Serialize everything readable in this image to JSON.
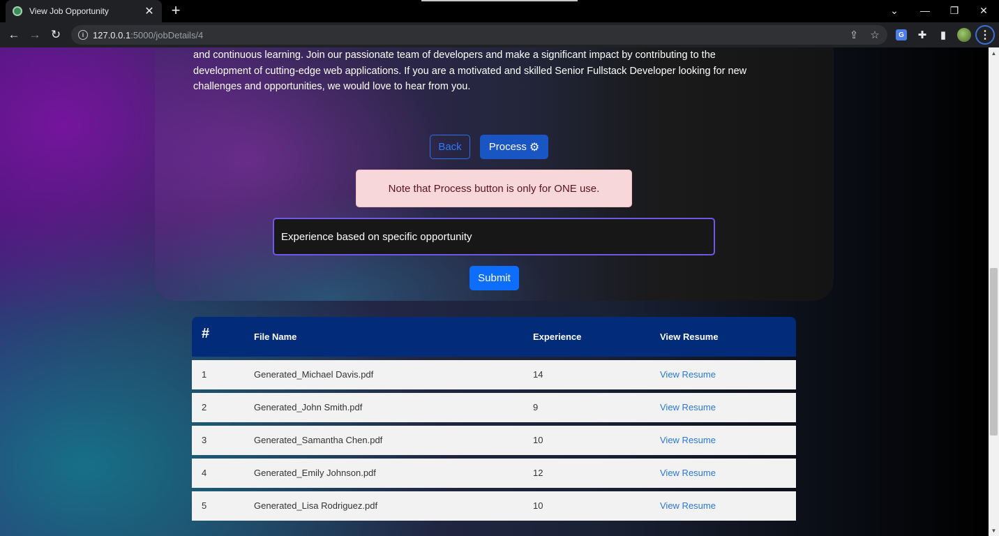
{
  "browser": {
    "tab_title": "View Job Opportunity",
    "url_host": "127.0.0.1",
    "url_path": ":5000/jobDetails/4",
    "new_tab_symbol": "+",
    "close_symbol": "✕"
  },
  "page": {
    "description": "and continuous learning. Join our passionate team of developers and make a significant impact by contributing to the development of cutting-edge web applications. If you are a motivated and skilled Senior Fullstack Developer looking for new challenges and opportunities, we would love to hear from you.",
    "back_label": "Back",
    "process_label": "Process",
    "alert_text": "Note that Process button is only for ONE use.",
    "experience_input_value": "Experience based on specific opportunity",
    "submit_label": "Submit"
  },
  "table": {
    "headers": [
      "#",
      "File Name",
      "Experience",
      "View Resume"
    ],
    "rows": [
      {
        "num": "1",
        "file": "Generated_Michael Davis.pdf",
        "experience": "14",
        "link": "View Resume"
      },
      {
        "num": "2",
        "file": "Generated_John Smith.pdf",
        "experience": "9",
        "link": "View Resume"
      },
      {
        "num": "3",
        "file": "Generated_Samantha Chen.pdf",
        "experience": "10",
        "link": "View Resume"
      },
      {
        "num": "4",
        "file": "Generated_Emily Johnson.pdf",
        "experience": "12",
        "link": "View Resume"
      },
      {
        "num": "5",
        "file": "Generated_Lisa Rodriguez.pdf",
        "experience": "10",
        "link": "View Resume"
      }
    ]
  },
  "colors": {
    "table_header": "#022b7a",
    "primary_button": "#0d6efd",
    "alert_bg": "#f8d7da",
    "input_border": "#6f58e8",
    "link": "#2a78d4"
  },
  "icons": [
    "back-arrow-icon",
    "forward-arrow-icon",
    "reload-icon",
    "info-icon",
    "share-icon",
    "star-icon",
    "translate-icon",
    "extensions-icon",
    "side-panel-icon",
    "profile-icon",
    "menu-icon",
    "gear-icon"
  ]
}
